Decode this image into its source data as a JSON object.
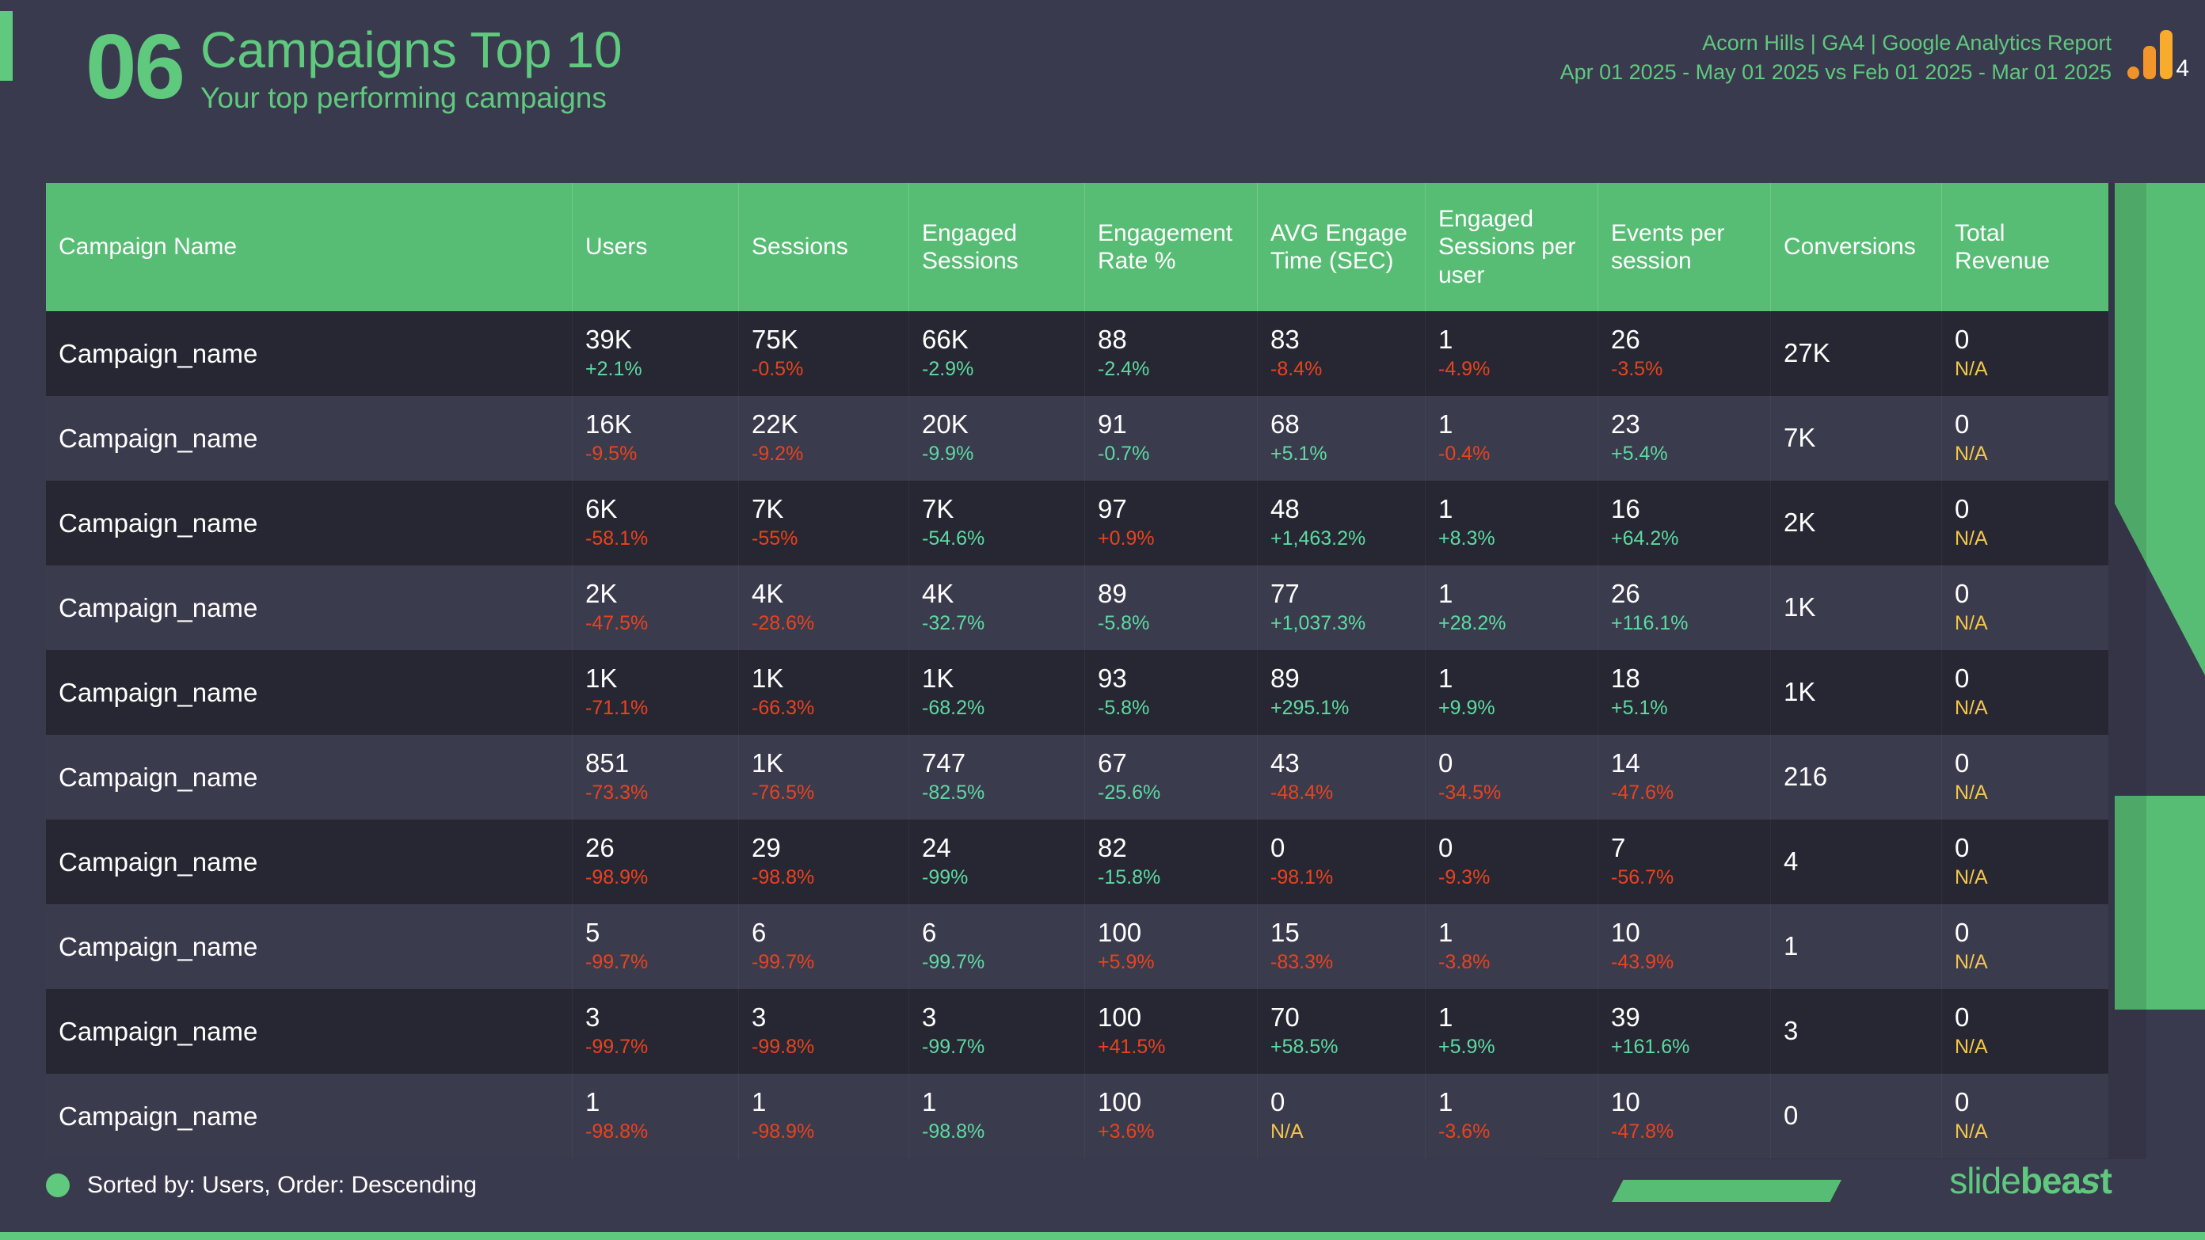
{
  "header": {
    "slide_number": "06",
    "title": "Campaigns Top 10",
    "subtitle": "Your top performing campaigns",
    "meta_line1": "Acorn Hills | GA4 | Google Analytics Report",
    "meta_line2": "Apr 01 2025 - May 01 2025 vs Feb 01 2025 - Mar 01 2025",
    "ga_badge_number": "4"
  },
  "table": {
    "columns": [
      "Campaign Name",
      "Users",
      "Sessions",
      "Engaged Sessions",
      "Engagement Rate %",
      "AVG Engage Time (SEC)",
      "Engaged Sessions per user",
      "Events per session",
      "Conversions",
      "Total Revenue"
    ],
    "rows": [
      {
        "name": "Campaign_name",
        "cells": [
          {
            "value": "39K",
            "delta": "+2.1%",
            "dir": "up"
          },
          {
            "value": "75K",
            "delta": "-0.5%",
            "dir": "down"
          },
          {
            "value": "66K",
            "delta": "-2.9%",
            "dir": "up"
          },
          {
            "value": "88",
            "delta": "-2.4%",
            "dir": "up"
          },
          {
            "value": "83",
            "delta": "-8.4%",
            "dir": "down"
          },
          {
            "value": "1",
            "delta": "-4.9%",
            "dir": "down"
          },
          {
            "value": "26",
            "delta": "-3.5%",
            "dir": "down"
          },
          {
            "value": "27K",
            "delta": "",
            "dir": "none"
          },
          {
            "value": "0",
            "delta": "N/A",
            "dir": "na"
          }
        ]
      },
      {
        "name": "Campaign_name",
        "cells": [
          {
            "value": "16K",
            "delta": "-9.5%",
            "dir": "down"
          },
          {
            "value": "22K",
            "delta": "-9.2%",
            "dir": "down"
          },
          {
            "value": "20K",
            "delta": "-9.9%",
            "dir": "up"
          },
          {
            "value": "91",
            "delta": "-0.7%",
            "dir": "up"
          },
          {
            "value": "68",
            "delta": "+5.1%",
            "dir": "up"
          },
          {
            "value": "1",
            "delta": "-0.4%",
            "dir": "down"
          },
          {
            "value": "23",
            "delta": "+5.4%",
            "dir": "up"
          },
          {
            "value": "7K",
            "delta": "",
            "dir": "none"
          },
          {
            "value": "0",
            "delta": "N/A",
            "dir": "na"
          }
        ]
      },
      {
        "name": "Campaign_name",
        "cells": [
          {
            "value": "6K",
            "delta": "-58.1%",
            "dir": "down"
          },
          {
            "value": "7K",
            "delta": "-55%",
            "dir": "down"
          },
          {
            "value": "7K",
            "delta": "-54.6%",
            "dir": "up"
          },
          {
            "value": "97",
            "delta": "+0.9%",
            "dir": "down"
          },
          {
            "value": "48",
            "delta": "+1,463.2%",
            "dir": "up"
          },
          {
            "value": "1",
            "delta": "+8.3%",
            "dir": "up"
          },
          {
            "value": "16",
            "delta": "+64.2%",
            "dir": "up"
          },
          {
            "value": "2K",
            "delta": "",
            "dir": "none"
          },
          {
            "value": "0",
            "delta": "N/A",
            "dir": "na"
          }
        ]
      },
      {
        "name": "Campaign_name",
        "cells": [
          {
            "value": "2K",
            "delta": "-47.5%",
            "dir": "down"
          },
          {
            "value": "4K",
            "delta": "-28.6%",
            "dir": "down"
          },
          {
            "value": "4K",
            "delta": "-32.7%",
            "dir": "up"
          },
          {
            "value": "89",
            "delta": "-5.8%",
            "dir": "up"
          },
          {
            "value": "77",
            "delta": "+1,037.3%",
            "dir": "up"
          },
          {
            "value": "1",
            "delta": "+28.2%",
            "dir": "up"
          },
          {
            "value": "26",
            "delta": "+116.1%",
            "dir": "up"
          },
          {
            "value": "1K",
            "delta": "",
            "dir": "none"
          },
          {
            "value": "0",
            "delta": "N/A",
            "dir": "na"
          }
        ]
      },
      {
        "name": "Campaign_name",
        "cells": [
          {
            "value": "1K",
            "delta": "-71.1%",
            "dir": "down"
          },
          {
            "value": "1K",
            "delta": "-66.3%",
            "dir": "down"
          },
          {
            "value": "1K",
            "delta": "-68.2%",
            "dir": "up"
          },
          {
            "value": "93",
            "delta": "-5.8%",
            "dir": "up"
          },
          {
            "value": "89",
            "delta": "+295.1%",
            "dir": "up"
          },
          {
            "value": "1",
            "delta": "+9.9%",
            "dir": "up"
          },
          {
            "value": "18",
            "delta": "+5.1%",
            "dir": "up"
          },
          {
            "value": "1K",
            "delta": "",
            "dir": "none"
          },
          {
            "value": "0",
            "delta": "N/A",
            "dir": "na"
          }
        ]
      },
      {
        "name": "Campaign_name",
        "cells": [
          {
            "value": "851",
            "delta": "-73.3%",
            "dir": "down"
          },
          {
            "value": "1K",
            "delta": "-76.5%",
            "dir": "down"
          },
          {
            "value": "747",
            "delta": "-82.5%",
            "dir": "up"
          },
          {
            "value": "67",
            "delta": "-25.6%",
            "dir": "up"
          },
          {
            "value": "43",
            "delta": "-48.4%",
            "dir": "down"
          },
          {
            "value": "0",
            "delta": "-34.5%",
            "dir": "down"
          },
          {
            "value": "14",
            "delta": "-47.6%",
            "dir": "down"
          },
          {
            "value": "216",
            "delta": "",
            "dir": "none"
          },
          {
            "value": "0",
            "delta": "N/A",
            "dir": "na"
          }
        ]
      },
      {
        "name": "Campaign_name",
        "cells": [
          {
            "value": "26",
            "delta": "-98.9%",
            "dir": "down"
          },
          {
            "value": "29",
            "delta": "-98.8%",
            "dir": "down"
          },
          {
            "value": "24",
            "delta": "-99%",
            "dir": "up"
          },
          {
            "value": "82",
            "delta": "-15.8%",
            "dir": "up"
          },
          {
            "value": "0",
            "delta": "-98.1%",
            "dir": "down"
          },
          {
            "value": "0",
            "delta": "-9.3%",
            "dir": "down"
          },
          {
            "value": "7",
            "delta": "-56.7%",
            "dir": "down"
          },
          {
            "value": "4",
            "delta": "",
            "dir": "none"
          },
          {
            "value": "0",
            "delta": "N/A",
            "dir": "na"
          }
        ]
      },
      {
        "name": "Campaign_name",
        "cells": [
          {
            "value": "5",
            "delta": "-99.7%",
            "dir": "down"
          },
          {
            "value": "6",
            "delta": "-99.7%",
            "dir": "down"
          },
          {
            "value": "6",
            "delta": "-99.7%",
            "dir": "up"
          },
          {
            "value": "100",
            "delta": "+5.9%",
            "dir": "down"
          },
          {
            "value": "15",
            "delta": "-83.3%",
            "dir": "down"
          },
          {
            "value": "1",
            "delta": "-3.8%",
            "dir": "down"
          },
          {
            "value": "10",
            "delta": "-43.9%",
            "dir": "down"
          },
          {
            "value": "1",
            "delta": "",
            "dir": "none"
          },
          {
            "value": "0",
            "delta": "N/A",
            "dir": "na"
          }
        ]
      },
      {
        "name": "Campaign_name",
        "cells": [
          {
            "value": "3",
            "delta": "-99.7%",
            "dir": "down"
          },
          {
            "value": "3",
            "delta": "-99.8%",
            "dir": "down"
          },
          {
            "value": "3",
            "delta": "-99.7%",
            "dir": "up"
          },
          {
            "value": "100",
            "delta": "+41.5%",
            "dir": "down"
          },
          {
            "value": "70",
            "delta": "+58.5%",
            "dir": "up"
          },
          {
            "value": "1",
            "delta": "+5.9%",
            "dir": "up"
          },
          {
            "value": "39",
            "delta": "+161.6%",
            "dir": "up"
          },
          {
            "value": "3",
            "delta": "",
            "dir": "none"
          },
          {
            "value": "0",
            "delta": "N/A",
            "dir": "na"
          }
        ]
      },
      {
        "name": "Campaign_name",
        "cells": [
          {
            "value": "1",
            "delta": "-98.8%",
            "dir": "down"
          },
          {
            "value": "1",
            "delta": "-98.9%",
            "dir": "down"
          },
          {
            "value": "1",
            "delta": "-98.8%",
            "dir": "up"
          },
          {
            "value": "100",
            "delta": "+3.6%",
            "dir": "down"
          },
          {
            "value": "0",
            "delta": "N/A",
            "dir": "na"
          },
          {
            "value": "1",
            "delta": "-3.6%",
            "dir": "down"
          },
          {
            "value": "10",
            "delta": "-47.8%",
            "dir": "down"
          },
          {
            "value": "0",
            "delta": "",
            "dir": "none"
          },
          {
            "value": "0",
            "delta": "N/A",
            "dir": "na"
          }
        ]
      }
    ]
  },
  "footer": {
    "sorted_text": "Sorted by: Users, Order: Descending",
    "brand_light": "slide",
    "brand_bold": "bea",
    "brand_bolt": "s",
    "brand_tail": "t"
  },
  "colors": {
    "accent_green": "#5fc97e",
    "header_green": "#57bd74",
    "delta_up": "#5ddaa0",
    "delta_down": "#e8431d",
    "delta_na": "#f4c64a",
    "bg": "#3a3a4e",
    "row_odd": "#272733",
    "row_even": "#3b3b4e"
  }
}
